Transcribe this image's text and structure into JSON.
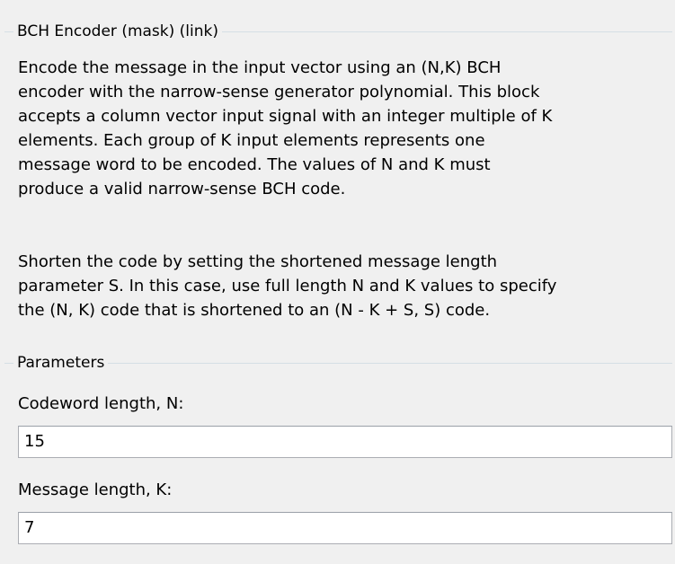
{
  "description": {
    "title": "BCH Encoder (mask) (link)",
    "para1_lines": [
      "Encode the message in the input vector using an (N,K) BCH",
      "encoder with the narrow-sense generator polynomial.  This block",
      "accepts a column vector input signal with an integer multiple of K",
      "elements.  Each group of K input elements represents one",
      "message word to be encoded.  The values of N and K must",
      "produce a valid narrow-sense BCH code."
    ],
    "para2_lines": [
      "Shorten the code by setting the shortened message length",
      "parameter S. In this case, use full length N and K values to specify",
      "the (N, K) code that is shortened to an (N - K + S, S) code."
    ]
  },
  "parameters": {
    "title": "Parameters",
    "codeword_length": {
      "label": "Codeword length, N:",
      "value": "15"
    },
    "message_length": {
      "label": "Message length, K:",
      "value": "7"
    }
  }
}
